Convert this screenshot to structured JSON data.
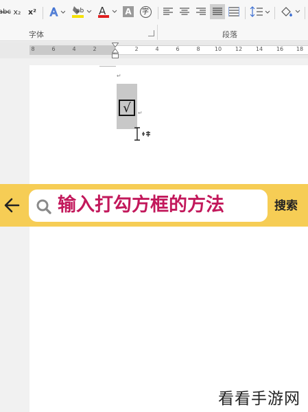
{
  "ribbon": {
    "strike_label": "abc",
    "subscript_label": "x₂",
    "superscript_label": "x²",
    "highlight_color": "#f5e100",
    "font_color": "#e02020",
    "char_shading_label": "A",
    "enclose_char_label": "字",
    "font_group_label": "字体",
    "paragraph_group_label": "段落",
    "icons": [
      "text-effect-icon",
      "highlight-icon",
      "font-color-icon",
      "char-shading-icon",
      "enclose-char-icon",
      "align-left-icon",
      "align-center-icon",
      "align-right-icon",
      "justify-icon",
      "distributed-icon",
      "line-spacing-icon",
      "shading-icon"
    ]
  },
  "ruler": {
    "ticks": [
      "8",
      "6",
      "4",
      "2",
      "",
      "2",
      "4",
      "6",
      "8",
      "10",
      "12",
      "14",
      "16",
      "18"
    ]
  },
  "document": {
    "paragraph_mark": "↵",
    "checkbox_symbol": "√"
  },
  "search_banner": {
    "query": "输入打勾方框的方法",
    "search_button": "搜索",
    "background_color": "#f6cd55",
    "query_color": "#c2185b"
  },
  "watermark": {
    "text": "看看手游网"
  }
}
